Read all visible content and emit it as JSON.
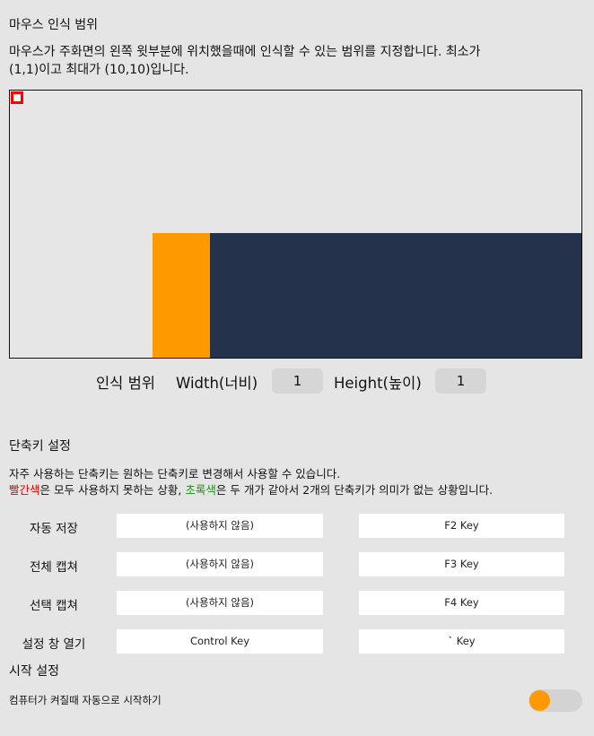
{
  "mouse_range": {
    "title": "마우스 인식 범위",
    "desc_line1": "마우스가 주화면의 왼쪽 윗부분에 위치했을때에 인식할 수 있는 범위를 지정합니다. 최소가",
    "desc_line2": "(1,1)이고 최대가 (10,10)입니다.",
    "range_label": "인식 범위",
    "width_label": "Width(너비)",
    "width_value": "1",
    "height_label": "Height(높이)",
    "height_value": "1"
  },
  "shortcut": {
    "title": "단축키 설정",
    "desc_line1": "자주 사용하는 단축키는 원하는 단축키로 변경해서 사용할 수 있습니다.",
    "desc_red": "빨간색",
    "desc_mid1": "은 모두 사용하지 못하는 상황, ",
    "desc_green": "초록색",
    "desc_mid2": "은 두 개가 같아서 2개의 단축키가 의미가 없는 상황입니다.",
    "rows": [
      {
        "label": "자동 저장",
        "key1": "(사용하지 않음)",
        "key2": "F2 Key"
      },
      {
        "label": "전체 캡쳐",
        "key1": "(사용하지 않음)",
        "key2": "F3 Key"
      },
      {
        "label": "선택 캡쳐",
        "key1": "(사용하지 않음)",
        "key2": "F4 Key"
      },
      {
        "label": "설정 창 열기",
        "key1": "Control Key",
        "key2": "` Key"
      }
    ]
  },
  "startup": {
    "title": "시작 설정",
    "autostart_label": "컴퓨터가 켜질때 자동으로 시작하기",
    "autostart_on": true
  },
  "colors": {
    "accent_orange": "#ff9900",
    "navy": "#25324b",
    "marker_red": "#ff0000"
  }
}
